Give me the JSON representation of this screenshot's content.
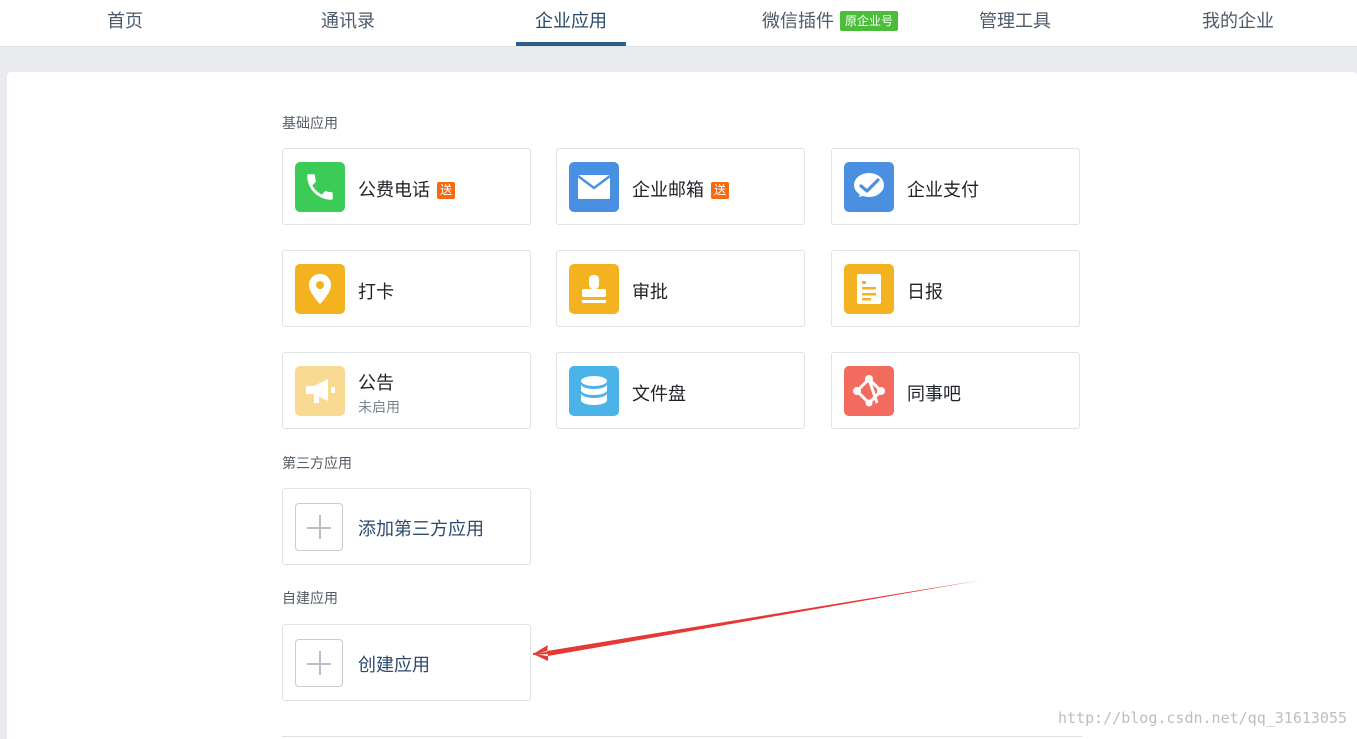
{
  "nav": {
    "items": [
      {
        "label": "首页"
      },
      {
        "label": "通讯录"
      },
      {
        "label": "企业应用"
      },
      {
        "label": "微信插件",
        "badge": "原企业号"
      },
      {
        "label": "管理工具"
      },
      {
        "label": "我的企业"
      }
    ],
    "active_index": 2
  },
  "sections": {
    "basic": {
      "title": "基础应用"
    },
    "third_party": {
      "title": "第三方应用"
    },
    "custom": {
      "title": "自建应用"
    }
  },
  "apps": [
    {
      "name": "公费电话",
      "badge": "送",
      "icon": "phone-icon",
      "color": "#3dcb57"
    },
    {
      "name": "企业邮箱",
      "badge": "送",
      "icon": "mail-icon",
      "color": "#4a90e2"
    },
    {
      "name": "企业支付",
      "icon": "pay-check-icon",
      "color": "#4a8fe0"
    },
    {
      "name": "打卡",
      "icon": "location-pin-icon",
      "color": "#f3b21f"
    },
    {
      "name": "审批",
      "icon": "stamp-icon",
      "color": "#f3b21f"
    },
    {
      "name": "日报",
      "icon": "report-doc-icon",
      "color": "#f3b21f"
    },
    {
      "name": "公告",
      "subtitle": "未启用",
      "icon": "megaphone-icon",
      "color": "#f9da92"
    },
    {
      "name": "文件盘",
      "icon": "database-icon",
      "color": "#4bb3e8"
    },
    {
      "name": "同事吧",
      "icon": "network-icon",
      "color": "#f26b5e"
    }
  ],
  "third_party": {
    "add_label": "添加第三方应用",
    "icon": "plus-icon"
  },
  "custom": {
    "create_label": "创建应用",
    "icon": "plus-icon"
  },
  "annotation": {
    "color": "#e53935"
  },
  "watermark": "http://blog.csdn.net/qq_31613055"
}
